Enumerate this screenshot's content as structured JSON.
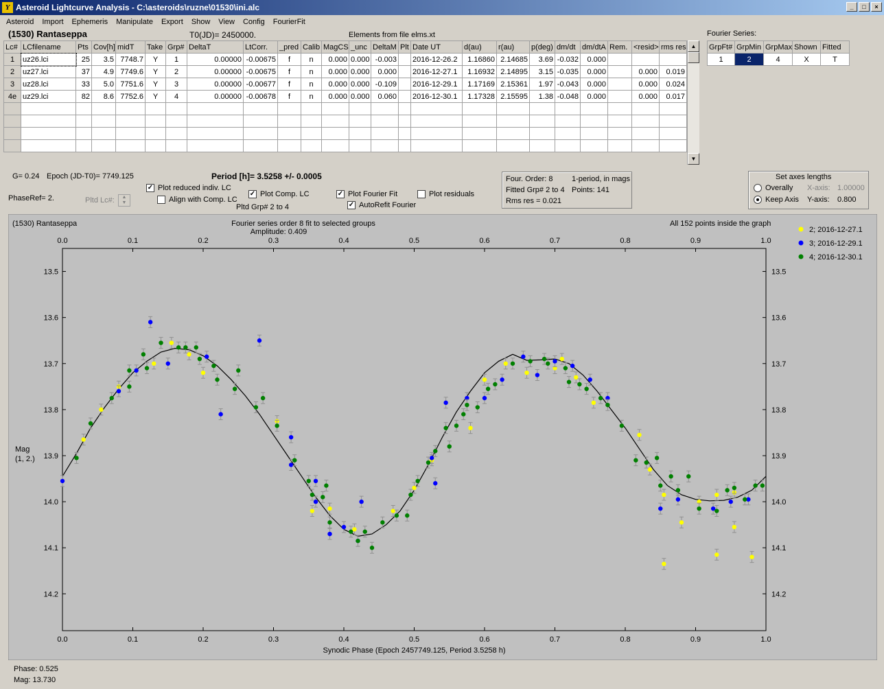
{
  "window": {
    "title": "Asteroid Lightcurve Analysis - C:\\asteroids\\ruzne\\01530\\ini.alc",
    "min": "_",
    "max": "□",
    "close": "×"
  },
  "menu": [
    "Asteroid",
    "Import",
    "Ephemeris",
    "Manipulate",
    "Export",
    "Show",
    "View",
    "Config",
    "FourierFit"
  ],
  "header": {
    "asteroid": "(1530) Rantaseppa",
    "t0": "T0(JD)= 2450000.",
    "elements": "Elements from file elms.xt"
  },
  "lc_table": {
    "columns": [
      "Lc#",
      "LCfilename",
      "Pts",
      "Cov[h]",
      "midT",
      "Take",
      "Grp#",
      "DeltaT",
      "LtCorr.",
      "_pred",
      "Calib",
      "MagCS",
      "_unc",
      "DeltaM",
      "Plt",
      "Date UT",
      "d(au)",
      "r(au)",
      "p(deg)",
      "dm/dt",
      "dm/dtA",
      "Rem.",
      "<resid>",
      "rms res"
    ],
    "rows": [
      [
        "1",
        "uz26.lci",
        "25",
        "3.5",
        "7748.7",
        "Y",
        "1",
        "0.00000",
        "-0.00675",
        "f",
        "n",
        "0.000",
        "0.000",
        "-0.003",
        "",
        "2016-12-26.2",
        "1.16860",
        "2.14685",
        "3.69",
        "-0.032",
        "0.000",
        "",
        "",
        ""
      ],
      [
        "2",
        "uz27.lci",
        "37",
        "4.9",
        "7749.6",
        "Y",
        "2",
        "0.00000",
        "-0.00675",
        "f",
        "n",
        "0.000",
        "0.000",
        "0.000",
        "",
        "2016-12-27.1",
        "1.16932",
        "2.14895",
        "3.15",
        "-0.035",
        "0.000",
        "",
        "0.000",
        "0.019"
      ],
      [
        "3",
        "uz28.lci",
        "33",
        "5.0",
        "7751.6",
        "Y",
        "3",
        "0.00000",
        "-0.00677",
        "f",
        "n",
        "0.000",
        "0.000",
        "-0.109",
        "",
        "2016-12-29.1",
        "1.17169",
        "2.15361",
        "1.97",
        "-0.043",
        "0.000",
        "",
        "0.000",
        "0.024"
      ],
      [
        "4e",
        "uz29.lci",
        "82",
        "8.6",
        "7752.6",
        "Y",
        "4",
        "0.00000",
        "-0.00678",
        "f",
        "n",
        "0.000",
        "0.000",
        "0.060",
        "",
        "2016-12-30.1",
        "1.17328",
        "2.15595",
        "1.38",
        "-0.048",
        "0.000",
        "",
        "0.000",
        "0.017"
      ]
    ]
  },
  "fourier_series": {
    "label": "Fourier Series:",
    "columns": [
      "GrpFt#",
      "GrpMin",
      "GrpMax",
      "Shown",
      "Fitted"
    ],
    "row": [
      "1",
      "2",
      "4",
      "X",
      "T"
    ]
  },
  "info": {
    "g": "G= 0.24",
    "epoch": "Epoch (JD-T0)= 7749.125",
    "period": "Period [h]= 3.5258 +/- 0.0005",
    "phaseref": "PhaseRef= 2.",
    "pltd_lc": "Pltd Lc#:",
    "pltd_grp": "Pltd Grp#  2  to  4"
  },
  "checks": {
    "plot_reduced": {
      "label": "Plot reduced indiv. LC",
      "checked": true
    },
    "align_comp": {
      "label": "Align with Comp. LC",
      "checked": false
    },
    "plot_comp": {
      "label": "Plot Comp. LC",
      "checked": true
    },
    "plot_fourier": {
      "label": "Plot Fourier Fit",
      "checked": true
    },
    "autorefit": {
      "label": "AutoRefit Fourier",
      "checked": true
    },
    "plot_residuals": {
      "label": "Plot residuals",
      "checked": false
    }
  },
  "fitinfo": {
    "order": "Four. Order:  8",
    "period_mode": "1-period, in mags",
    "fitted": "Fitted Grp# 2 to 4",
    "points": "Points: 141",
    "rms": "Rms res     = 0.021"
  },
  "axes_box": {
    "title": "Set axes lengths",
    "overally": "Overally",
    "keep": "Keep Axis",
    "xaxis_label": "X-axis:",
    "xaxis_value": "1.00000",
    "yaxis_label": "Y-axis:",
    "yaxis_value": "0.800",
    "selected": "keep"
  },
  "status": {
    "phase": "Phase:  0.525",
    "mag": "Mag:    13.730"
  },
  "chart_data": {
    "type": "scatter",
    "title": "(1530) Rantaseppa",
    "subtitle": "Fourier series order 8 fit to selected groups",
    "amplitude": "Amplitude: 0.409",
    "note": "All 152 points inside the graph",
    "xlabel": "Synodic Phase (Epoch 2457749.125, Period 3.5258 h)",
    "ylabel": "Mag",
    "ylabel2": "(1, 2.)",
    "xlim": [
      0,
      1.0
    ],
    "ylim": [
      13.45,
      14.28
    ],
    "yticks": [
      "13.5",
      "13.6",
      "13.7",
      "13.8",
      "13.9",
      "14.0",
      "14.1",
      "14.2"
    ],
    "xticks": [
      "0.0",
      "0.1",
      "0.2",
      "0.3",
      "0.4",
      "0.5",
      "0.6",
      "0.7",
      "0.8",
      "0.9",
      "1.0"
    ],
    "y_reversed": true,
    "fourier_curve": [
      [
        0.0,
        13.945
      ],
      [
        0.02,
        13.895
      ],
      [
        0.04,
        13.84
      ],
      [
        0.06,
        13.795
      ],
      [
        0.08,
        13.755
      ],
      [
        0.1,
        13.72
      ],
      [
        0.12,
        13.695
      ],
      [
        0.14,
        13.675
      ],
      [
        0.16,
        13.667
      ],
      [
        0.18,
        13.67
      ],
      [
        0.2,
        13.683
      ],
      [
        0.22,
        13.705
      ],
      [
        0.24,
        13.735
      ],
      [
        0.26,
        13.77
      ],
      [
        0.28,
        13.81
      ],
      [
        0.3,
        13.855
      ],
      [
        0.32,
        13.9
      ],
      [
        0.34,
        13.945
      ],
      [
        0.36,
        13.99
      ],
      [
        0.38,
        14.03
      ],
      [
        0.4,
        14.06
      ],
      [
        0.42,
        14.075
      ],
      [
        0.44,
        14.07
      ],
      [
        0.46,
        14.05
      ],
      [
        0.48,
        14.02
      ],
      [
        0.5,
        13.975
      ],
      [
        0.52,
        13.92
      ],
      [
        0.54,
        13.86
      ],
      [
        0.56,
        13.805
      ],
      [
        0.58,
        13.76
      ],
      [
        0.6,
        13.72
      ],
      [
        0.62,
        13.695
      ],
      [
        0.64,
        13.68
      ],
      [
        0.66,
        13.693
      ],
      [
        0.68,
        13.692
      ],
      [
        0.7,
        13.69
      ],
      [
        0.72,
        13.7
      ],
      [
        0.74,
        13.725
      ],
      [
        0.76,
        13.76
      ],
      [
        0.78,
        13.8
      ],
      [
        0.8,
        13.84
      ],
      [
        0.82,
        13.885
      ],
      [
        0.84,
        13.93
      ],
      [
        0.86,
        13.965
      ],
      [
        0.88,
        13.985
      ],
      [
        0.9,
        13.995
      ],
      [
        0.92,
        13.998
      ],
      [
        0.94,
        13.997
      ],
      [
        0.96,
        13.99
      ],
      [
        0.98,
        13.975
      ],
      [
        1.0,
        13.945
      ]
    ],
    "series": [
      {
        "name": "2; 2016-12-27.1",
        "color": "#ffff00",
        "points": [
          [
            0.03,
            13.865
          ],
          [
            0.055,
            13.8
          ],
          [
            0.08,
            13.75
          ],
          [
            0.13,
            13.7
          ],
          [
            0.155,
            13.655
          ],
          [
            0.18,
            13.68
          ],
          [
            0.2,
            13.72
          ],
          [
            0.305,
            13.825
          ],
          [
            0.355,
            14.02
          ],
          [
            0.38,
            14.015
          ],
          [
            0.415,
            14.06
          ],
          [
            0.47,
            14.02
          ],
          [
            0.5,
            13.97
          ],
          [
            0.525,
            13.91
          ],
          [
            0.58,
            13.84
          ],
          [
            0.6,
            13.735
          ],
          [
            0.63,
            13.7
          ],
          [
            0.66,
            13.72
          ],
          [
            0.7,
            13.71
          ],
          [
            0.71,
            13.69
          ],
          [
            0.73,
            13.73
          ],
          [
            0.755,
            13.785
          ],
          [
            0.82,
            13.855
          ],
          [
            0.835,
            13.93
          ],
          [
            0.855,
            13.985
          ],
          [
            0.855,
            14.135
          ],
          [
            0.88,
            14.045
          ],
          [
            0.905,
            14.0
          ],
          [
            0.93,
            14.115
          ],
          [
            0.93,
            13.985
          ],
          [
            0.955,
            14.055
          ],
          [
            0.955,
            13.98
          ],
          [
            0.98,
            14.12
          ]
        ]
      },
      {
        "name": "3; 2016-12-29.1",
        "color": "#0000ff",
        "points": [
          [
            0.0,
            13.955
          ],
          [
            0.08,
            13.76
          ],
          [
            0.105,
            13.715
          ],
          [
            0.125,
            13.61
          ],
          [
            0.15,
            13.7
          ],
          [
            0.205,
            13.685
          ],
          [
            0.225,
            13.81
          ],
          [
            0.28,
            13.65
          ],
          [
            0.325,
            13.86
          ],
          [
            0.325,
            13.92
          ],
          [
            0.36,
            14.0
          ],
          [
            0.36,
            13.955
          ],
          [
            0.38,
            14.07
          ],
          [
            0.4,
            14.055
          ],
          [
            0.42,
            14.085
          ],
          [
            0.425,
            14.0
          ],
          [
            0.525,
            13.905
          ],
          [
            0.53,
            13.96
          ],
          [
            0.545,
            13.785
          ],
          [
            0.575,
            13.775
          ],
          [
            0.6,
            13.775
          ],
          [
            0.625,
            13.735
          ],
          [
            0.655,
            13.685
          ],
          [
            0.675,
            13.725
          ],
          [
            0.7,
            13.695
          ],
          [
            0.725,
            13.705
          ],
          [
            0.75,
            13.735
          ],
          [
            0.775,
            13.775
          ],
          [
            0.85,
            14.015
          ],
          [
            0.875,
            13.995
          ],
          [
            0.925,
            14.015
          ],
          [
            0.95,
            14.0
          ],
          [
            0.975,
            13.995
          ]
        ]
      },
      {
        "name": "4; 2016-12-30.1",
        "color": "#008000",
        "points": [
          [
            0.02,
            13.905
          ],
          [
            0.04,
            13.83
          ],
          [
            0.07,
            13.775
          ],
          [
            0.095,
            13.715
          ],
          [
            0.095,
            13.75
          ],
          [
            0.115,
            13.68
          ],
          [
            0.12,
            13.71
          ],
          [
            0.14,
            13.655
          ],
          [
            0.165,
            13.665
          ],
          [
            0.175,
            13.665
          ],
          [
            0.19,
            13.665
          ],
          [
            0.195,
            13.69
          ],
          [
            0.215,
            13.705
          ],
          [
            0.22,
            13.735
          ],
          [
            0.245,
            13.755
          ],
          [
            0.25,
            13.715
          ],
          [
            0.275,
            13.795
          ],
          [
            0.285,
            13.775
          ],
          [
            0.305,
            13.835
          ],
          [
            0.33,
            13.91
          ],
          [
            0.35,
            13.955
          ],
          [
            0.355,
            13.985
          ],
          [
            0.37,
            13.99
          ],
          [
            0.375,
            13.965
          ],
          [
            0.38,
            14.045
          ],
          [
            0.41,
            14.065
          ],
          [
            0.42,
            14.085
          ],
          [
            0.43,
            14.065
          ],
          [
            0.44,
            14.1
          ],
          [
            0.455,
            14.045
          ],
          [
            0.475,
            14.03
          ],
          [
            0.49,
            14.03
          ],
          [
            0.495,
            13.985
          ],
          [
            0.505,
            13.955
          ],
          [
            0.52,
            13.915
          ],
          [
            0.53,
            13.89
          ],
          [
            0.545,
            13.84
          ],
          [
            0.55,
            13.88
          ],
          [
            0.56,
            13.835
          ],
          [
            0.57,
            13.81
          ],
          [
            0.575,
            13.79
          ],
          [
            0.59,
            13.795
          ],
          [
            0.605,
            13.755
          ],
          [
            0.615,
            13.745
          ],
          [
            0.64,
            13.7
          ],
          [
            0.665,
            13.695
          ],
          [
            0.685,
            13.69
          ],
          [
            0.69,
            13.7
          ],
          [
            0.715,
            13.71
          ],
          [
            0.72,
            13.74
          ],
          [
            0.735,
            13.745
          ],
          [
            0.745,
            13.755
          ],
          [
            0.765,
            13.775
          ],
          [
            0.775,
            13.79
          ],
          [
            0.795,
            13.835
          ],
          [
            0.815,
            13.91
          ],
          [
            0.83,
            13.915
          ],
          [
            0.845,
            13.905
          ],
          [
            0.85,
            13.965
          ],
          [
            0.865,
            13.945
          ],
          [
            0.875,
            13.975
          ],
          [
            0.89,
            13.945
          ],
          [
            0.905,
            14.015
          ],
          [
            0.93,
            14.02
          ],
          [
            0.945,
            13.975
          ],
          [
            0.955,
            13.97
          ],
          [
            0.97,
            13.995
          ],
          [
            0.985,
            13.965
          ],
          [
            0.995,
            13.965
          ]
        ]
      }
    ]
  }
}
